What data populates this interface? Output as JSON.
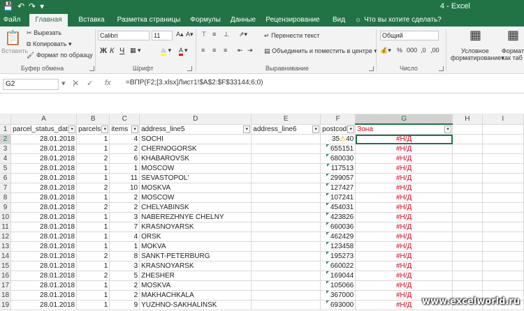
{
  "window": {
    "title": "4 - Excel"
  },
  "tabs": [
    {
      "label": "Файл",
      "active": false
    },
    {
      "label": "Главная",
      "active": true
    },
    {
      "label": "Вставка",
      "active": false
    },
    {
      "label": "Разметка страницы",
      "active": false
    },
    {
      "label": "Формулы",
      "active": false
    },
    {
      "label": "Данные",
      "active": false
    },
    {
      "label": "Рецензирование",
      "active": false
    },
    {
      "label": "Вид",
      "active": false
    }
  ],
  "tell_me": "Что вы хотите сделать?",
  "ribbon": {
    "clipboard": {
      "paste": "Вставить",
      "cut": "Вырезать",
      "copy": "Копировать",
      "format_painter": "Формат по образцу",
      "label": "Буфер обмена"
    },
    "font": {
      "name": "Calibri",
      "size": "11",
      "bold": "Ж",
      "italic": "К",
      "underline": "Ч",
      "label": "Шрифт"
    },
    "alignment": {
      "wrap": "Перенести текст",
      "merge": "Объединить и поместить в центре",
      "label": "Выравнивание"
    },
    "number": {
      "format": "Общий",
      "label": "Число"
    },
    "styles": {
      "conditional": "Условное",
      "conditional2": "форматирование",
      "format_table": "Формати",
      "format_table2": "как таб"
    }
  },
  "formula_bar": {
    "name_box": "G2",
    "fx": "fx",
    "formula": "=ВПР(F2;[3.xlsx]Лист1!$A$2:$F$33144;6;0)"
  },
  "grid": {
    "columns": [
      "A",
      "B",
      "C",
      "D",
      "E",
      "F",
      "G",
      "H",
      "I"
    ],
    "headers": [
      "parcel_status_dat",
      "parcels",
      "items",
      "address_line5",
      "address_line6",
      "postcod",
      "Зона"
    ],
    "rows": [
      {
        "n": "2",
        "date": "28.01.2018",
        "parcels": "1",
        "items": "4",
        "addr": "SOCHI",
        "post": "35",
        "post2": "40",
        "zone": "#Н/Д"
      },
      {
        "n": "3",
        "date": "28.01.2018",
        "parcels": "1",
        "items": "2",
        "addr": "CHERNOGORSK",
        "post": "655151",
        "zone": "#Н/Д"
      },
      {
        "n": "4",
        "date": "28.01.2018",
        "parcels": "2",
        "items": "6",
        "addr": "KHABAROVSK",
        "post": "680030",
        "zone": "#Н/Д"
      },
      {
        "n": "5",
        "date": "28.01.2018",
        "parcels": "1",
        "items": "1",
        "addr": "MOSCOW",
        "post": "117513",
        "zone": "#Н/Д"
      },
      {
        "n": "6",
        "date": "28.01.2018",
        "parcels": "1",
        "items": "11",
        "addr": "SEVASTOPOL'",
        "post": "299057",
        "zone": "#Н/Д"
      },
      {
        "n": "7",
        "date": "28.01.2018",
        "parcels": "2",
        "items": "10",
        "addr": "MOSKVA",
        "post": "127427",
        "zone": "#Н/Д"
      },
      {
        "n": "8",
        "date": "28.01.2018",
        "parcels": "1",
        "items": "2",
        "addr": "MOSCOW",
        "post": "107241",
        "zone": "#Н/Д"
      },
      {
        "n": "9",
        "date": "28.01.2018",
        "parcels": "2",
        "items": "2",
        "addr": "CHELYABINSK",
        "post": "454031",
        "zone": "#Н/Д"
      },
      {
        "n": "10",
        "date": "28.01.2018",
        "parcels": "1",
        "items": "3",
        "addr": "NABEREZHNYE CHELNY",
        "post": "423826",
        "zone": "#Н/Д"
      },
      {
        "n": "11",
        "date": "28.01.2018",
        "parcels": "1",
        "items": "7",
        "addr": "KRASNOYARSK",
        "post": "660036",
        "zone": "#Н/Д"
      },
      {
        "n": "12",
        "date": "28.01.2018",
        "parcels": "1",
        "items": "4",
        "addr": "ORSK",
        "post": "462429",
        "zone": "#Н/Д"
      },
      {
        "n": "13",
        "date": "28.01.2018",
        "parcels": "1",
        "items": "1",
        "addr": "MOKVA",
        "post": "123458",
        "zone": "#Н/Д"
      },
      {
        "n": "14",
        "date": "28.01.2018",
        "parcels": "2",
        "items": "8",
        "addr": "SANKT-PETERBURG",
        "post": "195273",
        "zone": "#Н/Д"
      },
      {
        "n": "15",
        "date": "28.01.2018",
        "parcels": "1",
        "items": "3",
        "addr": "KRASNOYARSK",
        "post": "660022",
        "zone": "#Н/Д"
      },
      {
        "n": "16",
        "date": "28.01.2018",
        "parcels": "2",
        "items": "5",
        "addr": "ZHESHER",
        "post": "169044",
        "zone": "#Н/Д"
      },
      {
        "n": "17",
        "date": "28.01.2018",
        "parcels": "1",
        "items": "2",
        "addr": "MOSKVA",
        "post": "105066",
        "zone": "#Н/Д"
      },
      {
        "n": "18",
        "date": "28.01.2018",
        "parcels": "1",
        "items": "2",
        "addr": "MAKHACHKALA",
        "post": "367000",
        "zone": "#Н/Д"
      },
      {
        "n": "19",
        "date": "28.01.2018",
        "parcels": "1",
        "items": "9",
        "addr": "YUZHNO-SAKHALINSK",
        "post": "693000",
        "zone": "#Н/Д"
      }
    ]
  },
  "watermark": "www.excelworld.ru",
  "colors": {
    "excel_green": "#217346",
    "error_red": "#e0001a"
  }
}
